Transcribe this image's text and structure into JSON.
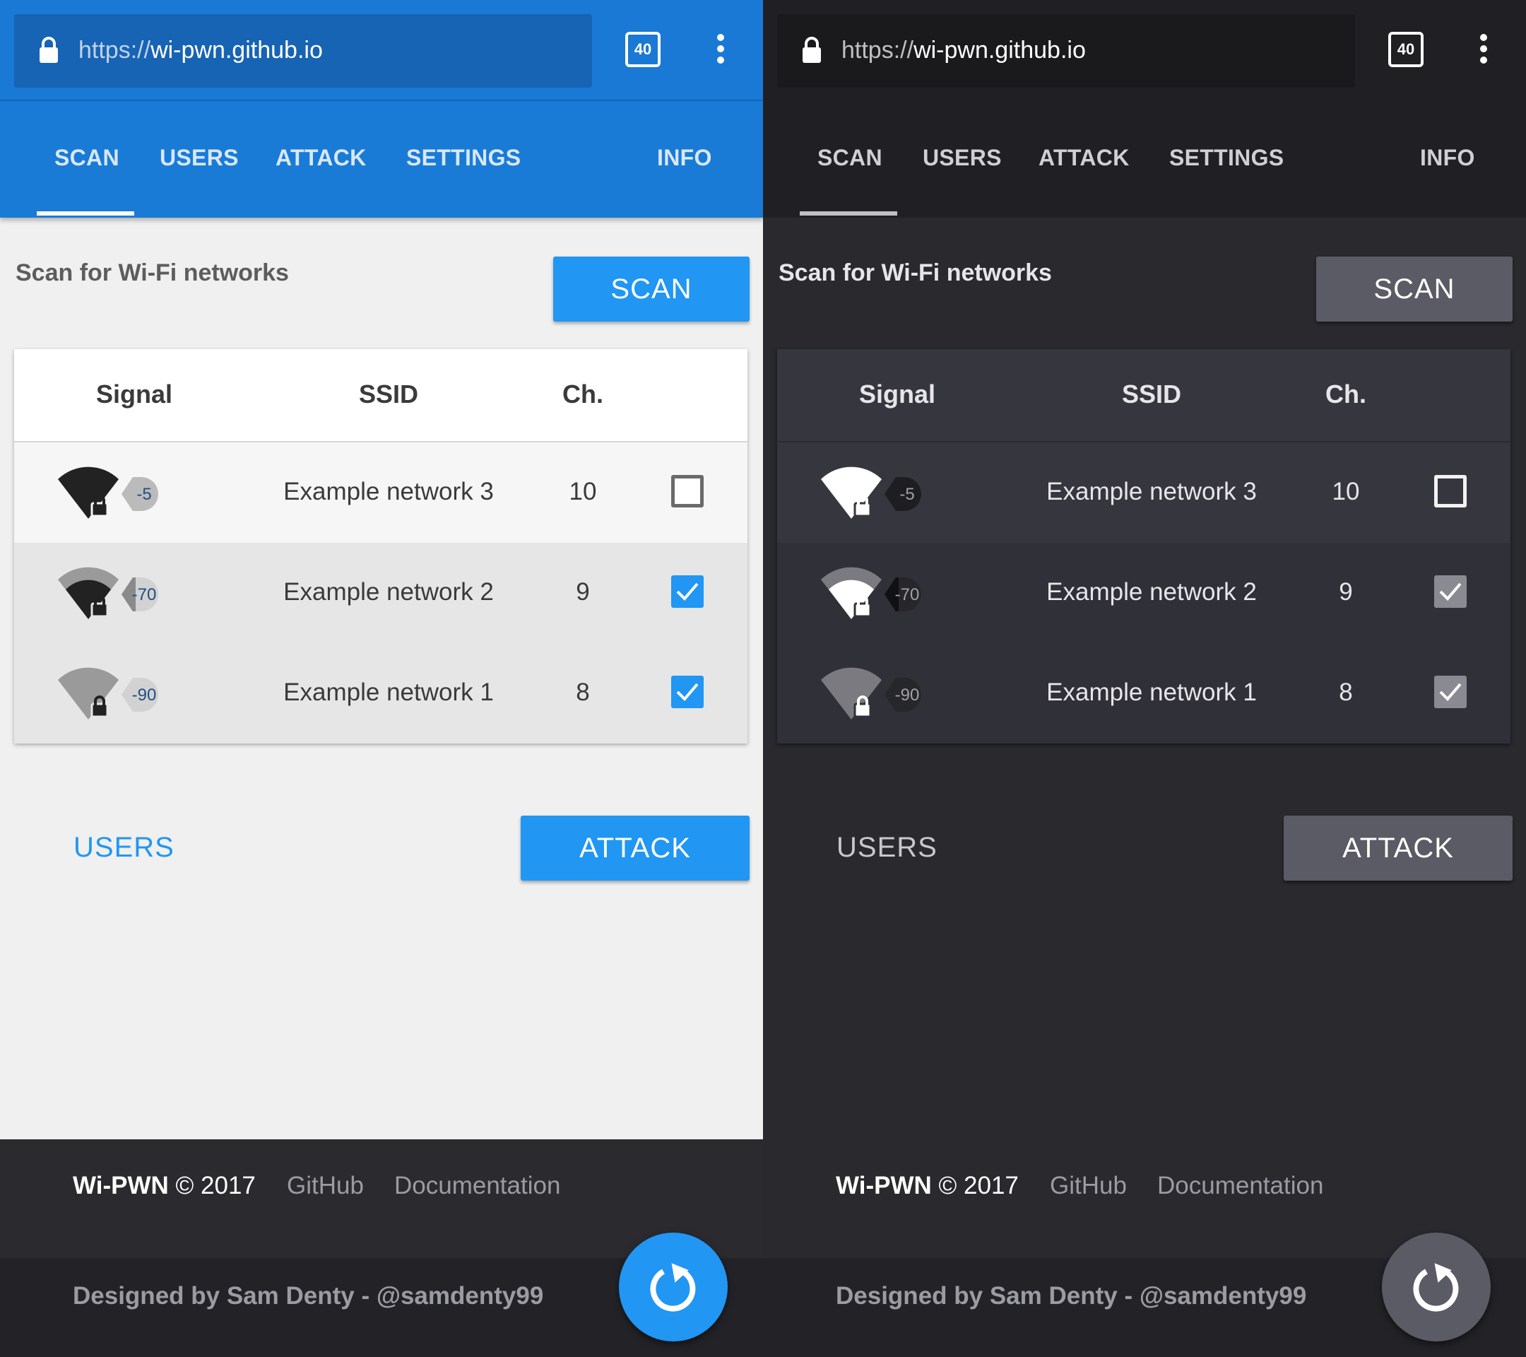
{
  "browser": {
    "url_scheme": "https://",
    "url_host": "wi-pwn.github.io",
    "tab_count": "40"
  },
  "nav": {
    "tabs": [
      {
        "label": "SCAN",
        "active": true
      },
      {
        "label": "USERS",
        "active": false
      },
      {
        "label": "ATTACK",
        "active": false
      },
      {
        "label": "SETTINGS",
        "active": false
      },
      {
        "label": "INFO",
        "active": false
      }
    ]
  },
  "scan": {
    "label": "Scan for Wi-Fi networks",
    "button": "SCAN"
  },
  "table": {
    "headers": {
      "signal": "Signal",
      "ssid": "SSID",
      "channel": "Ch."
    },
    "rows": [
      {
        "rssi": "-5",
        "ssid": "Example network 3",
        "channel": "10",
        "selected": false,
        "locked": true
      },
      {
        "rssi": "-70",
        "ssid": "Example network 2",
        "channel": "9",
        "selected": true,
        "locked": true
      },
      {
        "rssi": "-90",
        "ssid": "Example network 1",
        "channel": "8",
        "selected": true,
        "locked": true
      }
    ]
  },
  "actions": {
    "users_link": "USERS",
    "attack_button": "ATTACK"
  },
  "footer": {
    "brand": "Wi-PWN",
    "copyright": "© 2017",
    "github": "GitHub",
    "documentation": "Documentation",
    "designed_by": "Designed by Sam Denty - @samdenty99"
  },
  "themes": {
    "light": {
      "accent": "#2196f3",
      "header": "#1a79d4",
      "background": "#f0f0f0"
    },
    "dark": {
      "accent": "#5b5b66",
      "header": "#202024",
      "background": "#29292e"
    }
  },
  "icons": [
    "lock-icon",
    "tabs-count-icon",
    "more-vert-icon",
    "wifi-signal-icon",
    "check-icon",
    "refresh-icon"
  ]
}
